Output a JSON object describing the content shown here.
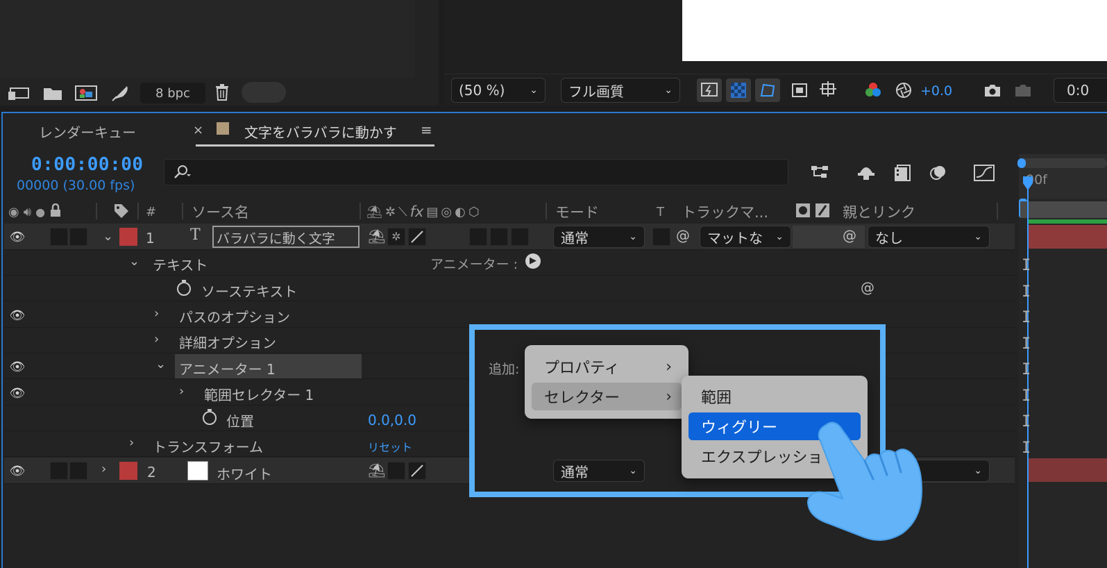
{
  "project_footer": {
    "bpc": "8 bpc"
  },
  "viewer_toolbar": {
    "zoom": "(50 %)",
    "quality": "フル画質",
    "exposure": "+0.0",
    "timecode_partial": "0:0"
  },
  "timeline": {
    "tabs": [
      {
        "label": "レンダーキュー"
      },
      {
        "label": "文字をバラバラに動かす",
        "close": "×",
        "menu": "≡"
      }
    ],
    "current_time": "0:00:00:00",
    "frame_info": "00000 (30.00 fps)",
    "ruler_label": "00f",
    "columns": {
      "hash": "#",
      "source_name": "ソース名",
      "fx": "fx",
      "mode": "モード",
      "t": "T",
      "track_matte": "トラックマ...",
      "parent_link": "親とリンク"
    },
    "layers": [
      {
        "number": "1",
        "name": "バラバラに動く文字",
        "mode": "通常",
        "matte": "マットな",
        "parent": "なし",
        "label_color": "#b83a3a"
      },
      {
        "number": "2",
        "name": "ホワイト",
        "mode": "通常",
        "label_color": "#b83a3a"
      }
    ],
    "properties": {
      "text": "テキスト",
      "animator_label": "アニメーター :",
      "source_text": "ソーステキスト",
      "path_options": "パスのオプション",
      "more_options": "詳細オプション",
      "animator1": "アニメーター 1",
      "add_label": "追加:",
      "range_selector": "範囲セレクター 1",
      "position": "位置",
      "position_value": "0.0,0.0",
      "transform": "トランスフォーム",
      "reset": "リセット"
    }
  },
  "context_menu": {
    "items": [
      {
        "label": "プロパティ",
        "arrow": "›"
      },
      {
        "label": "セレクター",
        "arrow": "›"
      }
    ]
  },
  "submenu": {
    "items": [
      {
        "label": "範囲"
      },
      {
        "label": "ウィグリー"
      },
      {
        "label": "エクスプレッショ"
      }
    ]
  },
  "colors": {
    "accent": "#3d9cff",
    "highlight_box": "#5ab0f6",
    "menu_active": "#0d63d9"
  }
}
